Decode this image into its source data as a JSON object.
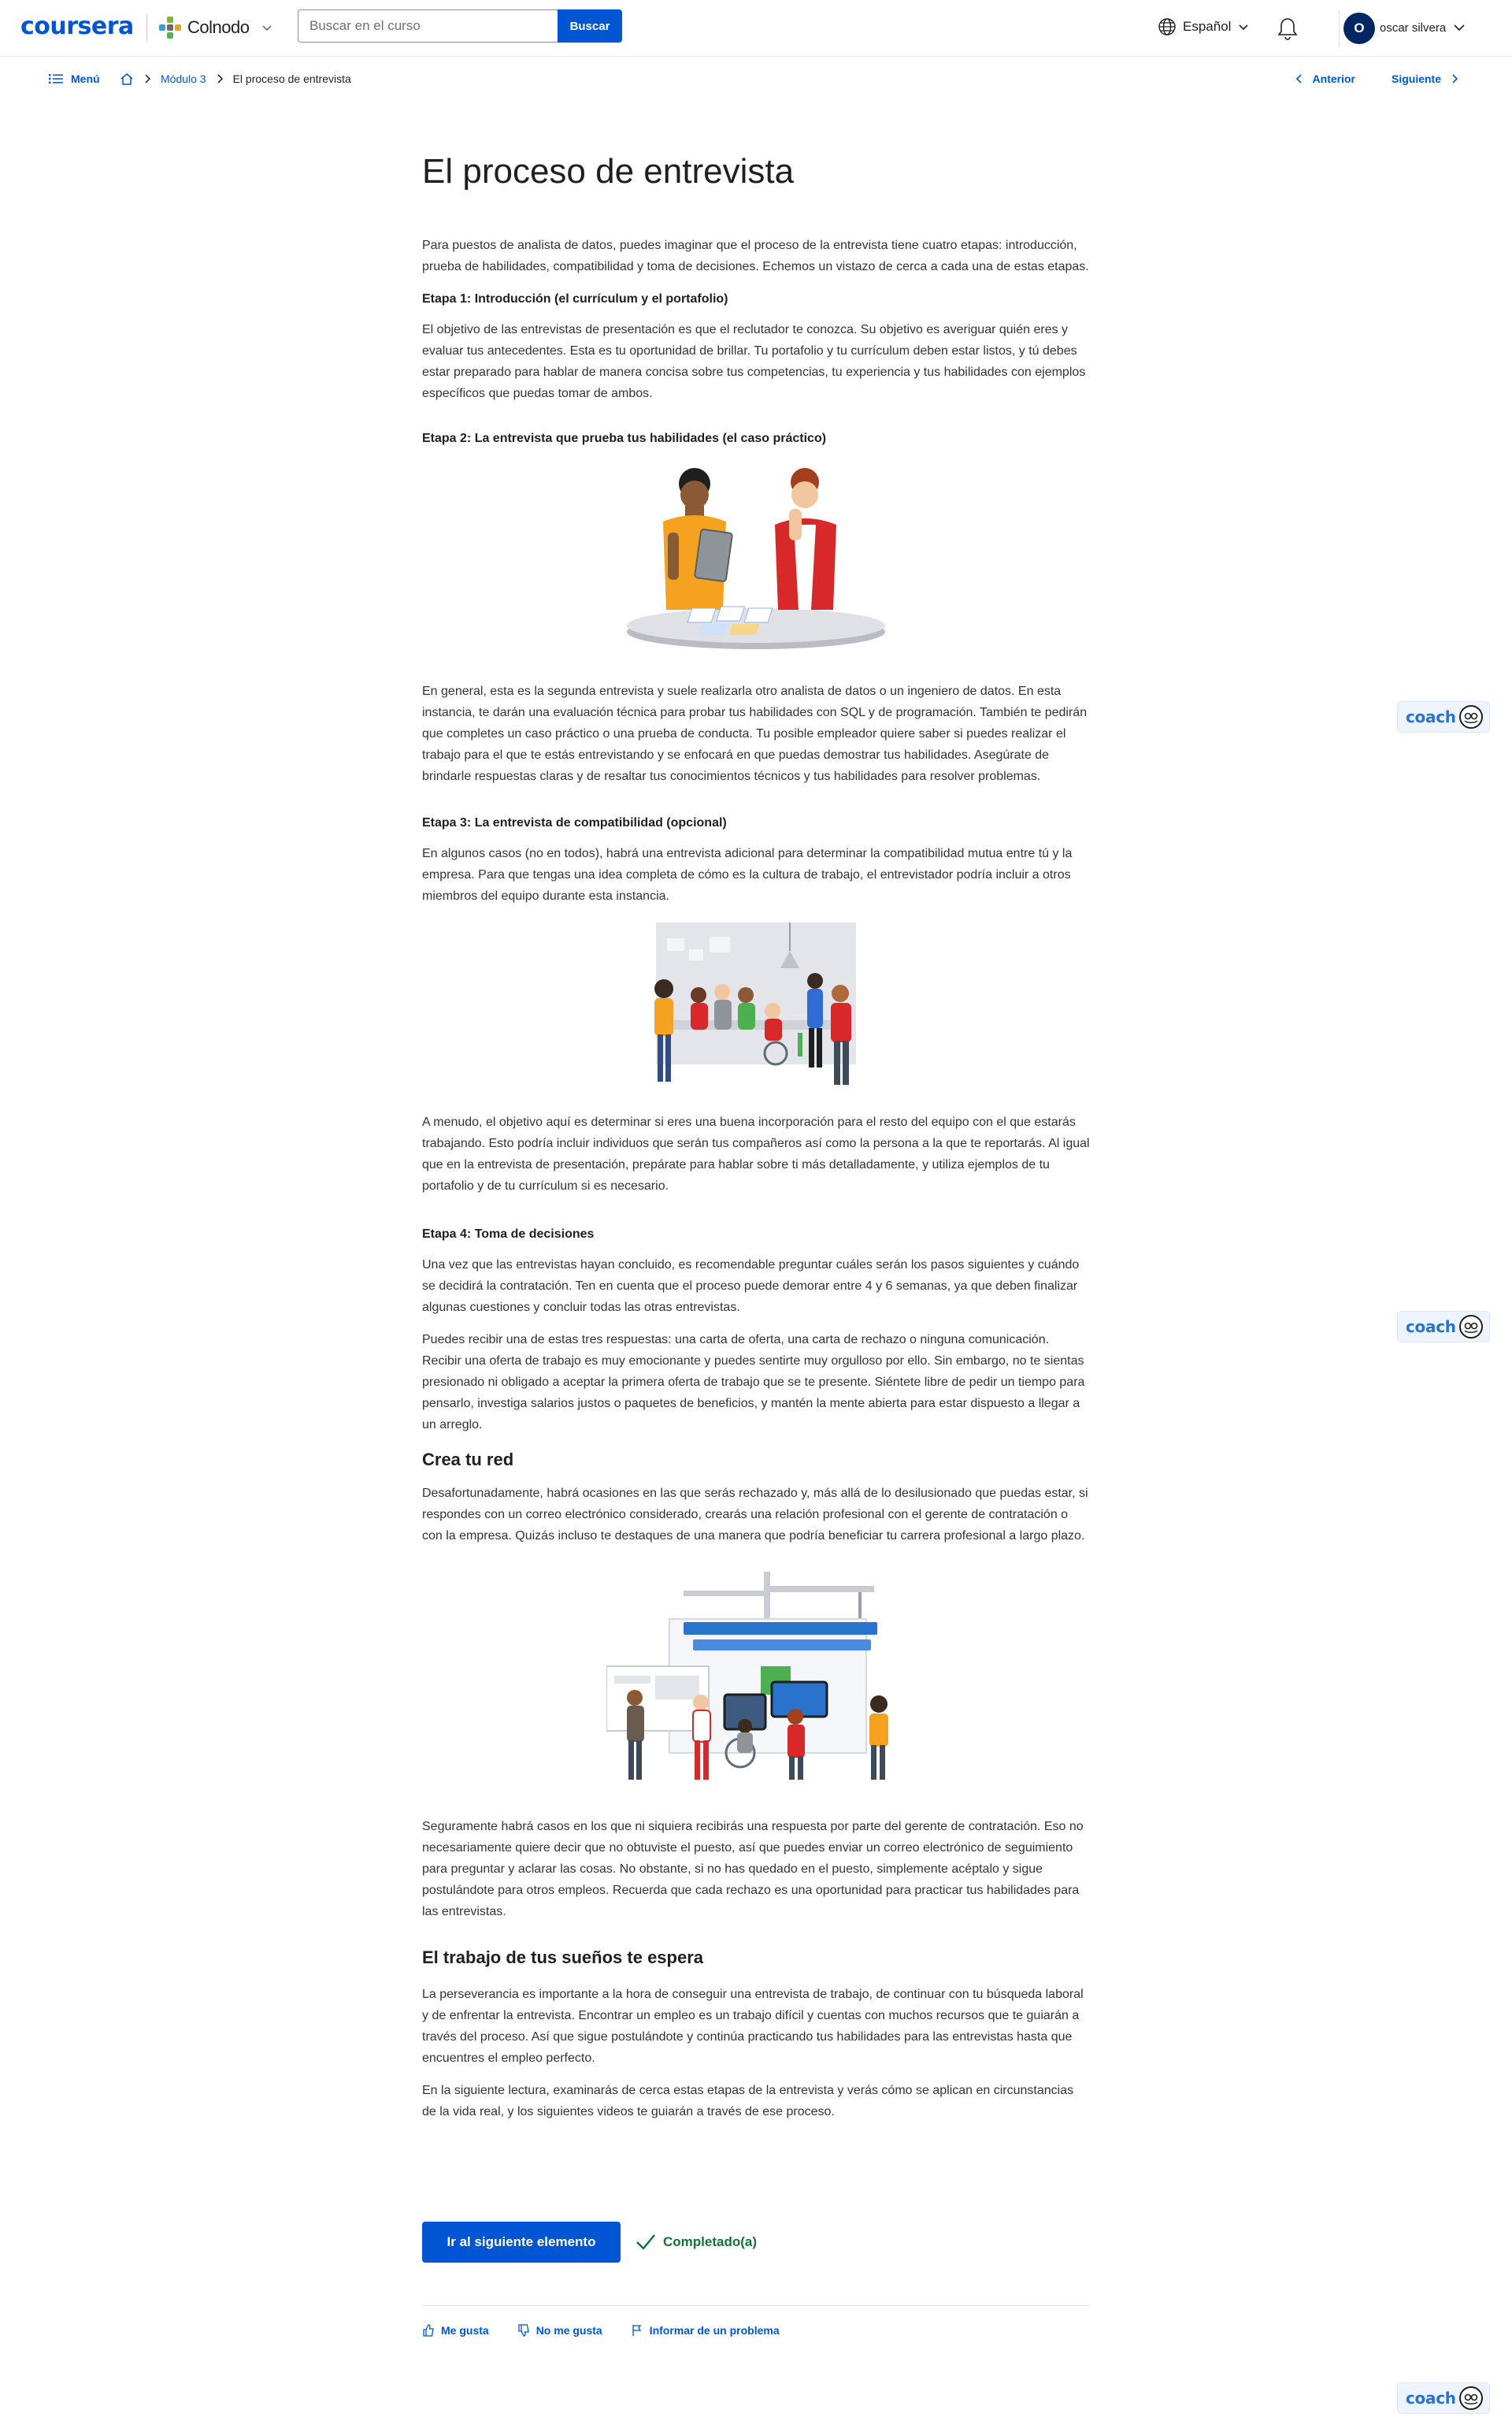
{
  "header": {
    "brand": "coursera",
    "partner": "Colnodo",
    "search_placeholder": "Buscar en el curso",
    "search_button": "Buscar",
    "language": "Español",
    "avatar_initial": "O",
    "username": "oscar silvera"
  },
  "subnav": {
    "menu": "Menú",
    "crumb_module": "Módulo 3",
    "crumb_current": "El proceso de entrevista",
    "prev": "Anterior",
    "next": "Siguiente"
  },
  "article": {
    "title": "El proceso de entrevista",
    "intro": "Para puestos de analista de datos, puedes imaginar que el proceso de la entrevista tiene cuatro etapas: introducción, prueba de habilidades, compatibilidad y toma de decisiones. Echemos un vistazo de cerca a cada una de estas etapas.",
    "stage1_title": "Etapa 1: Introducción (el currículum y el portafolio)",
    "stage1_text": "El objetivo de las entrevistas de presentación es que el reclutador te conozca. Su objetivo es averiguar quién eres y evaluar tus antecedentes. Esta es tu oportunidad de brillar. Tu portafolio y tu currículum deben estar listos, y tú debes estar preparado para hablar de manera concisa sobre tus competencias, tu experiencia y tus habilidades con ejemplos específicos que puedas tomar de ambos.",
    "stage2_title": "Etapa 2: La entrevista que prueba tus habilidades (el caso práctico)",
    "stage2_text": "En general, esta es la segunda entrevista y suele realizarla otro analista de datos o un ingeniero de datos. En esta instancia, te darán una evaluación técnica para probar tus habilidades con SQL y de programación. También te pedirán que completes un caso práctico o una prueba de conducta. Tu posible empleador quiere saber si puedes realizar el trabajo para el que te estás entrevistando y se enfocará en que puedas demostrar tus habilidades. Asegúrate de brindarle respuestas claras y de resaltar tus conocimientos técnicos y tus habilidades para resolver problemas.",
    "stage3_title": "Etapa 3: La entrevista de compatibilidad (opcional)",
    "stage3_text": "En algunos casos (no en todos), habrá una entrevista adicional para determinar la compatibilidad mutua entre tú y la empresa. Para que tengas una idea completa de cómo es la cultura de trabajo, el entrevistador podría incluir a otros miembros del equipo durante esta instancia.",
    "stage3_text2": "A menudo, el objetivo aquí es determinar si eres una buena incorporación para el resto del equipo con el que estarás trabajando. Esto podría incluir individuos que serán tus compañeros así como la persona a la que te reportarás. Al igual que en la entrevista de presentación, prepárate para hablar sobre ti más detalladamente, y utiliza ejemplos de tu portafolio y de tu currículum si es necesario.",
    "stage4_title": "Etapa 4: Toma de decisiones",
    "stage4_text": "Una vez que las entrevistas hayan concluido, es recomendable preguntar cuáles serán los pasos siguientes y cuándo se decidirá la contratación. Ten en cuenta que el proceso puede demorar entre 4 y 6 semanas, ya que deben finalizar algunas cuestiones y concluir todas las otras entrevistas.",
    "stage4_text2": "Puedes recibir una de estas tres respuestas: una carta de oferta, una carta de rechazo o ninguna comunicación. Recibir una oferta de trabajo es muy emocionante y puedes sentirte muy orgulloso por ello. Sin embargo, no te sientas presionado ni obligado a aceptar la primera oferta de trabajo que se te presente. Siéntete libre de pedir un tiempo para pensarlo, investiga salarios justos o paquetes de beneficios, y mantén la mente abierta para estar dispuesto a llegar a un arreglo.",
    "network_title": "Crea tu red",
    "network_text": "Desafortunadamente, habrá ocasiones en las que serás rechazado y, más allá de lo desilusionado que puedas estar, si respondes con un correo electrónico considerado, crearás una relación profesional con el gerente de contratación o con la empresa. Quizás incluso te destaques de una manera que podría beneficiar tu carrera profesional a largo plazo.",
    "network_text2": "Seguramente habrá casos en los que ni siquiera recibirás una respuesta por parte del gerente de contratación. Eso no necesariamente quiere decir que no obtuviste el puesto, así que puedes enviar un correo electrónico de seguimiento para preguntar y aclarar las cosas. No obstante, si no has quedado en el puesto, simplemente acéptalo y sigue postulándote para otros empleos. Recuerda que cada rechazo es una oportunidad para practicar tus habilidades para las entrevistas.",
    "dream_title": "El trabajo de tus sueños te espera",
    "dream_text": "La perseverancia es importante a la hora de conseguir una entrevista de trabajo, de continuar con tu búsqueda laboral y de enfrentar la entrevista. Encontrar un empleo es un trabajo difícil y cuentas con muchos recursos que te guiarán a través del proceso. Así que sigue postulándote y continúa practicando tus habilidades para las entrevistas hasta que encuentres el empleo perfecto.",
    "dream_text2": "En la siguiente lectura, examinarás de cerca estas etapas de la entrevista y verás cómo se aplican en circunstancias de la vida real, y los siguientes videos te guiarán a través de ese proceso."
  },
  "footer": {
    "next_item": "Ir al siguiente elemento",
    "completed": "Completado(a)",
    "like": "Me gusta",
    "dislike": "No me gusta",
    "report": "Informar de un problema"
  },
  "coach": {
    "label": "coach"
  },
  "colors": {
    "accent": "#0056d2",
    "success": "#137333",
    "text": "#1f1f1f",
    "body": "#333333"
  }
}
